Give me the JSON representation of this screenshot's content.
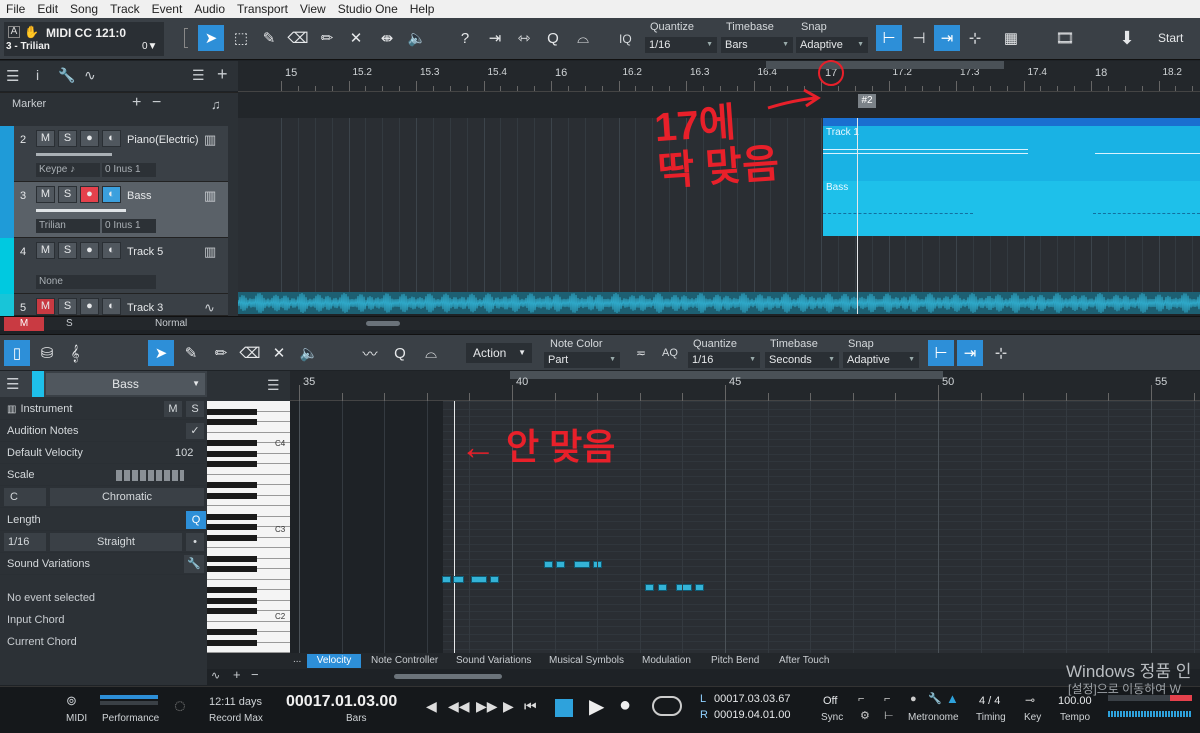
{
  "menu": [
    "File",
    "Edit",
    "Song",
    "Track",
    "Event",
    "Audio",
    "Transport",
    "View",
    "Studio One",
    "Help"
  ],
  "toolbar": {
    "device_title": "MIDI CC 121:0",
    "device_sub": "3 - Trilian",
    "device_value": "0▼",
    "quantize_label": "Quantize",
    "quantize_value": "1/16",
    "timebase_label": "Timebase",
    "timebase_value": "Bars",
    "snap_label": "Snap",
    "snap_value": "Adaptive",
    "iq": "IQ",
    "start": "Start"
  },
  "track_header": {
    "marker": "Marker"
  },
  "ruler_top": [
    "15",
    "15.2",
    "15.3",
    "15.4",
    "16",
    "16.2",
    "16.3",
    "16.4",
    "17",
    "17.2",
    "17.3",
    "17.4",
    "18",
    "18.2"
  ],
  "marker_tag": "#2",
  "tracks": [
    {
      "num": "2",
      "name": "Piano(Electric)",
      "inst": "Keype ♪",
      "input": "0 Inus 1"
    },
    {
      "num": "3",
      "name": "Bass",
      "inst": "Trilian",
      "input": "0 Inus 1"
    },
    {
      "num": "4",
      "name": "Track 5",
      "inst": "None"
    },
    {
      "num": "5",
      "name": "Track 3"
    }
  ],
  "event_labels": {
    "track1": "Track 1",
    "bass": "Bass"
  },
  "bottom_strip": {
    "m": "M",
    "s": "S",
    "mode": "Normal"
  },
  "annotation_top": "17에\n딱 맞음",
  "annotation_bottom": "← 안 맞음",
  "editor": {
    "action": "Action",
    "note_color_label": "Note Color",
    "note_color_value": "Part",
    "aq": "AQ",
    "quantize_label": "Quantize",
    "quantize_value": "1/16",
    "timebase_label": "Timebase",
    "timebase_value": "Seconds",
    "snap_label": "Snap",
    "snap_value": "Adaptive",
    "track_name": "Bass",
    "ruler": [
      "35",
      "40",
      "45",
      "50",
      "55"
    ],
    "keys": [
      "C4",
      "C3",
      "C2"
    ]
  },
  "inspector": {
    "instrument": "Instrument",
    "m": "M",
    "s": "S",
    "audition": "Audition Notes",
    "default_velocity": "Default Velocity",
    "velocity_value": "102",
    "scale": "Scale",
    "scale_root": "C",
    "scale_type": "Chromatic",
    "length": "Length",
    "length_q": "Q",
    "len_value": "1/16",
    "len_type": "Straight",
    "len_dot": "•",
    "sound_variations": "Sound Variations",
    "no_event": "No event selected",
    "input_chord": "Input Chord",
    "current_chord": "Current Chord"
  },
  "lanes": [
    "Velocity",
    "Note Controller",
    "Sound Variations",
    "Musical Symbols",
    "Modulation",
    "Pitch Bend",
    "After Touch"
  ],
  "lane_dots": "...",
  "transport": {
    "midi": "MIDI",
    "performance": "Performance",
    "days": "12:11 days",
    "record_max": "Record Max",
    "position": "00017.01.03.00",
    "position_unit": "Bars",
    "l_label": "L",
    "l_value": "00017.03.03.67",
    "r_label": "R",
    "r_value": "00019.04.01.00",
    "sync_value": "Off",
    "sync": "Sync",
    "metronome": "Metronome",
    "timing_value": "4 / 4",
    "timing": "Timing",
    "key": "Key",
    "tempo_value": "100.00",
    "tempo": "Tempo"
  },
  "watermark": {
    "line1": "Windows 정품 인",
    "line2": "[설정]으로 이동하여 W"
  },
  "colors": {
    "accent": "#2d8fd8",
    "event": "#19b2e4",
    "annotation": "#e8202a",
    "waveform": "#2fa8c8"
  }
}
